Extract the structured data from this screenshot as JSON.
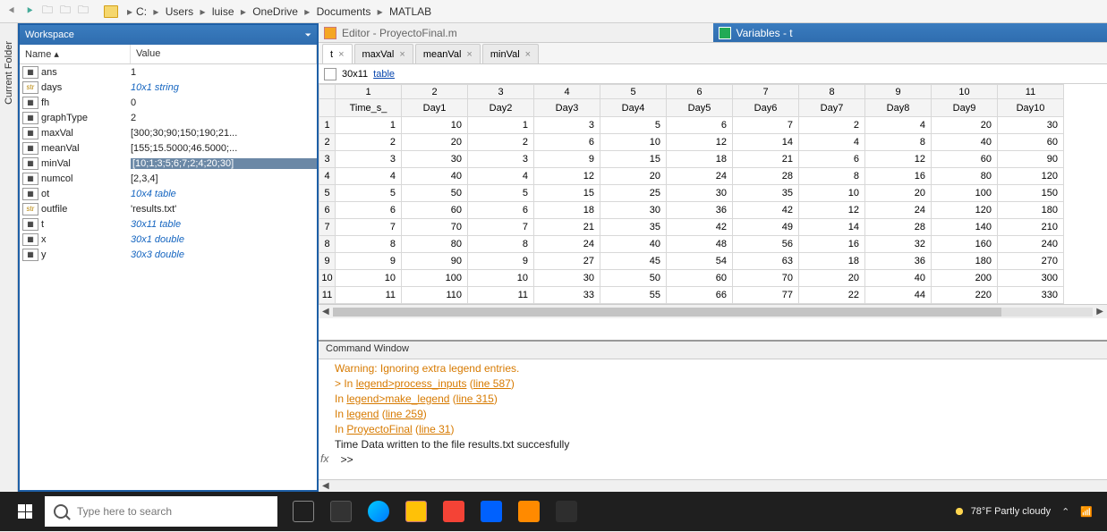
{
  "breadcrumb": [
    "C:",
    "Users",
    "luise",
    "OneDrive",
    "Documents",
    "MATLAB"
  ],
  "workspace": {
    "title": "Workspace",
    "headers": {
      "name": "Name ▴",
      "value": "Value"
    },
    "rows": [
      {
        "icon": "num",
        "name": "ans",
        "value": "1",
        "link": false
      },
      {
        "icon": "str",
        "name": "days",
        "value": "10x1 string",
        "link": true
      },
      {
        "icon": "num",
        "name": "fh",
        "value": "0",
        "link": false
      },
      {
        "icon": "num",
        "name": "graphType",
        "value": "2",
        "link": false
      },
      {
        "icon": "num",
        "name": "maxVal",
        "value": "[300;30;90;150;190;21...",
        "link": false
      },
      {
        "icon": "num",
        "name": "meanVal",
        "value": "[155;15.5000;46.5000;...",
        "link": false
      },
      {
        "icon": "num",
        "name": "minVal",
        "value": "[10;1;3;5;6;7;2;4;20;30]",
        "link": false,
        "sel": true
      },
      {
        "icon": "num",
        "name": "numcol",
        "value": "[2,3,4]",
        "link": false
      },
      {
        "icon": "tbl",
        "name": "ot",
        "value": "10x4 table",
        "link": true
      },
      {
        "icon": "str",
        "name": "outfile",
        "value": "'results.txt'",
        "link": false
      },
      {
        "icon": "tbl",
        "name": "t",
        "value": "30x11 table",
        "link": true
      },
      {
        "icon": "num",
        "name": "x",
        "value": "30x1 double",
        "link": true
      },
      {
        "icon": "num",
        "name": "y",
        "value": "30x3 double",
        "link": true
      }
    ]
  },
  "editor": {
    "title": "Editor - ProyectoFinal.m"
  },
  "variables": {
    "title": "Variables - t"
  },
  "tabs": [
    {
      "label": "t",
      "active": true
    },
    {
      "label": "maxVal",
      "active": false
    },
    {
      "label": "meanVal",
      "active": false
    },
    {
      "label": "minVal",
      "active": false
    }
  ],
  "tableInfo": {
    "dims": "30x11",
    "type": "table"
  },
  "grid": {
    "colNums": [
      "1",
      "2",
      "3",
      "4",
      "5",
      "6",
      "7",
      "8",
      "9",
      "10",
      "11"
    ],
    "colNames": [
      "Time_s_",
      "Day1",
      "Day2",
      "Day3",
      "Day4",
      "Day5",
      "Day6",
      "Day7",
      "Day8",
      "Day9",
      "Day10"
    ],
    "rowNums": [
      "1",
      "2",
      "3",
      "4",
      "5",
      "6",
      "7",
      "8",
      "9",
      "10",
      "11"
    ],
    "cells": [
      [
        "1",
        "10",
        "1",
        "3",
        "5",
        "6",
        "7",
        "2",
        "4",
        "20",
        "30"
      ],
      [
        "2",
        "20",
        "2",
        "6",
        "10",
        "12",
        "14",
        "4",
        "8",
        "40",
        "60"
      ],
      [
        "3",
        "30",
        "3",
        "9",
        "15",
        "18",
        "21",
        "6",
        "12",
        "60",
        "90"
      ],
      [
        "4",
        "40",
        "4",
        "12",
        "20",
        "24",
        "28",
        "8",
        "16",
        "80",
        "120"
      ],
      [
        "5",
        "50",
        "5",
        "15",
        "25",
        "30",
        "35",
        "10",
        "20",
        "100",
        "150"
      ],
      [
        "6",
        "60",
        "6",
        "18",
        "30",
        "36",
        "42",
        "12",
        "24",
        "120",
        "180"
      ],
      [
        "7",
        "70",
        "7",
        "21",
        "35",
        "42",
        "49",
        "14",
        "28",
        "140",
        "210"
      ],
      [
        "8",
        "80",
        "8",
        "24",
        "40",
        "48",
        "56",
        "16",
        "32",
        "160",
        "240"
      ],
      [
        "9",
        "90",
        "9",
        "27",
        "45",
        "54",
        "63",
        "18",
        "36",
        "180",
        "270"
      ],
      [
        "10",
        "100",
        "10",
        "30",
        "50",
        "60",
        "70",
        "20",
        "40",
        "200",
        "300"
      ],
      [
        "11",
        "110",
        "11",
        "33",
        "55",
        "66",
        "77",
        "22",
        "44",
        "220",
        "330"
      ]
    ]
  },
  "cmd": {
    "title": "Command Window",
    "lines": [
      {
        "cls": "warn",
        "txt": "Warning: Ignoring extra legend entries."
      },
      {
        "cls": "warn",
        "html": "> In <span class='ul'>legend>process_inputs</span> (<span class='ul'>line 587</span>)"
      },
      {
        "cls": "warn",
        "html": "In <span class='ul'>legend>make_legend</span> (<span class='ul'>line 315</span>)"
      },
      {
        "cls": "warn",
        "html": "In <span class='ul'>legend</span> (<span class='ul'>line 259</span>)"
      },
      {
        "cls": "warn",
        "html": "In <span class='ul'>ProyectoFinal</span> (<span class='ul'>line 31</span>)"
      },
      {
        "cls": "cmd-last",
        "txt": "    Time    Data written to the file results.txt succesfully"
      }
    ],
    "prompt": ">>"
  },
  "taskbar": {
    "search": "Type here to search",
    "weather": "78°F  Partly cloudy"
  }
}
